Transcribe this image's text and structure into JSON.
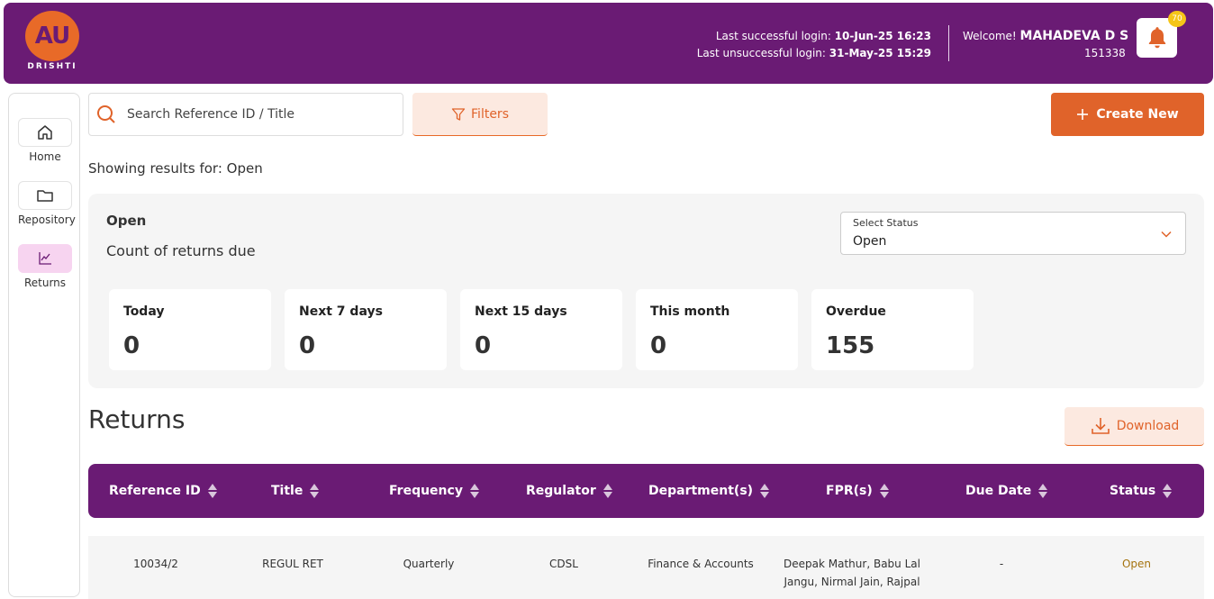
{
  "header": {
    "logo_text": "AU",
    "logo_subtitle": "DRISHTI",
    "last_success_label": "Last successful login:",
    "last_success_value": "10-Jun-25 16:23",
    "last_fail_label": "Last unsuccessful login:",
    "last_fail_value": "31-May-25 15:29",
    "welcome_label": "Welcome!",
    "user_name": "MAHADEVA D S",
    "user_id": "151338",
    "notification_count": "70"
  },
  "sidebar": {
    "items": [
      {
        "label": "Home",
        "icon": "home-icon"
      },
      {
        "label": "Repository",
        "icon": "folder-icon"
      },
      {
        "label": "Returns",
        "icon": "chart-icon"
      }
    ]
  },
  "toolbar": {
    "search_placeholder": "Search Reference ID / Title",
    "filters_label": "Filters",
    "create_label": "Create New"
  },
  "showing_text": "Showing results for: Open",
  "summary": {
    "title": "Open",
    "subtitle": "Count of returns due",
    "select_label": "Select Status",
    "select_value": "Open",
    "cards": [
      {
        "label": "Today",
        "value": "0"
      },
      {
        "label": "Next 7 days",
        "value": "0"
      },
      {
        "label": "Next 15 days",
        "value": "0"
      },
      {
        "label": "This month",
        "value": "0"
      },
      {
        "label": "Overdue",
        "value": "155"
      }
    ]
  },
  "returns": {
    "heading": "Returns",
    "download_label": "Download",
    "columns": [
      "Reference ID",
      "Title",
      "Frequency",
      "Regulator",
      "Department(s)",
      "FPR(s)",
      "Due Date",
      "Status"
    ],
    "rows": [
      {
        "reference_id": "10034/2",
        "title": "REGUL RET",
        "frequency": "Quarterly",
        "regulator": "CDSL",
        "department": "Finance & Accounts",
        "fpr": "Deepak Mathur, Babu Lal Jangu, Nirmal Jain, Rajpal",
        "due_date": "-",
        "status": "Open"
      }
    ]
  },
  "colors": {
    "brand_purple": "#6a1b74",
    "brand_orange": "#e0632a",
    "status_open": "#a5730f"
  }
}
